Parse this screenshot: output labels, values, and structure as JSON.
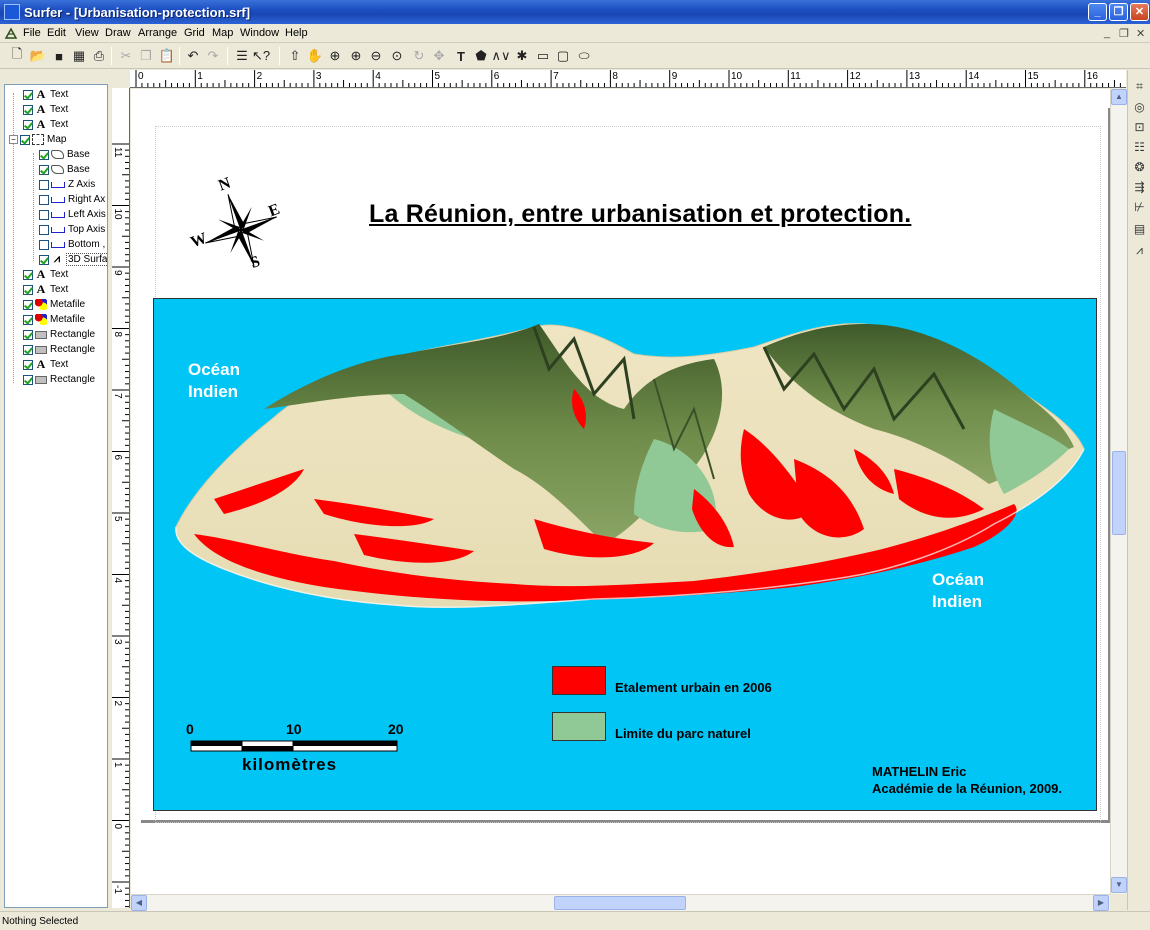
{
  "window": {
    "title": "Surfer - [Urbanisation-protection.srf]",
    "minimize_glyph": "_",
    "maximize_glyph": "❐",
    "close_glyph": "✕"
  },
  "menu": {
    "items": [
      "File",
      "Edit",
      "View",
      "Draw",
      "Arrange",
      "Grid",
      "Map",
      "Window",
      "Help"
    ],
    "mdi_minimize": "_",
    "mdi_restore": "❐",
    "mdi_close": "✕"
  },
  "toolbar": {
    "icons": [
      "new-icon",
      "open-icon",
      "save-icon",
      "grid-icon",
      "print-icon",
      "cut-icon",
      "copy-icon",
      "paste-icon",
      "undo-icon",
      "redo-icon",
      "object-manager-icon",
      "help-pointer-icon",
      "select-icon",
      "pan-icon",
      "zoom-in-icon",
      "zoom-realtime-icon",
      "zoom-out-icon",
      "zoom-selected-icon",
      "rotate-icon",
      "reshape-icon",
      "text-icon",
      "polygon-icon",
      "polyline-icon",
      "symbol-icon",
      "rectangle-icon",
      "rounded-rectangle-icon",
      "ellipse-icon"
    ]
  },
  "object_manager": {
    "items": [
      {
        "label": "Text",
        "type": "text",
        "checked": true,
        "level": 0
      },
      {
        "label": "Text",
        "type": "text",
        "checked": true,
        "level": 0
      },
      {
        "label": "Text",
        "type": "text",
        "checked": true,
        "level": 0
      },
      {
        "label": "Map",
        "type": "map",
        "checked": true,
        "level": 0,
        "expanded": true
      },
      {
        "label": "Base",
        "type": "base",
        "checked": true,
        "level": 1
      },
      {
        "label": "Base",
        "type": "base",
        "checked": true,
        "level": 1
      },
      {
        "label": "Z Axis",
        "type": "axis",
        "checked": false,
        "level": 1
      },
      {
        "label": "Right Ax",
        "type": "axis",
        "checked": false,
        "level": 1
      },
      {
        "label": "Left Axis",
        "type": "axis",
        "checked": false,
        "level": 1
      },
      {
        "label": "Top Axis",
        "type": "axis",
        "checked": false,
        "level": 1
      },
      {
        "label": "Bottom ,",
        "type": "axis",
        "checked": false,
        "level": 1
      },
      {
        "label": "3D Surfa",
        "type": "surface",
        "checked": true,
        "level": 1
      },
      {
        "label": "Text",
        "type": "text",
        "checked": true,
        "level": 0
      },
      {
        "label": "Text",
        "type": "text",
        "checked": true,
        "level": 0
      },
      {
        "label": "Metafile",
        "type": "metafile",
        "checked": true,
        "level": 0
      },
      {
        "label": "Metafile",
        "type": "metafile",
        "checked": true,
        "level": 0
      },
      {
        "label": "Rectangle",
        "type": "rect",
        "checked": true,
        "level": 0
      },
      {
        "label": "Rectangle",
        "type": "rect",
        "checked": true,
        "level": 0
      },
      {
        "label": "Text",
        "type": "text",
        "checked": true,
        "level": 0
      },
      {
        "label": "Rectangle",
        "type": "rect",
        "checked": true,
        "level": 0
      }
    ]
  },
  "rulers": {
    "horizontal_labels": [
      "0",
      "1",
      "2",
      "3",
      "4",
      "5",
      "6",
      "7",
      "8",
      "9",
      "10",
      "11",
      "12",
      "13",
      "14",
      "15",
      "16"
    ],
    "vertical_labels": [
      "11",
      "10",
      "9",
      "8",
      "7",
      "6",
      "5",
      "4",
      "3",
      "2",
      "1",
      "0",
      "-1"
    ]
  },
  "map": {
    "title": "La Réunion, entre urbanisation et protection.",
    "compass": {
      "n": "N",
      "e": "E",
      "s": "S",
      "w": "W"
    },
    "ocean_label_1": [
      "Océan",
      "Indien"
    ],
    "ocean_label_2": [
      "Océan",
      "Indien"
    ],
    "legend": [
      {
        "label": "Etalement urbain en 2006",
        "color": "#ff0000"
      },
      {
        "label": "Limite du parc naturel",
        "color": "#90c995"
      }
    ],
    "scale": {
      "ticks": [
        "0",
        "10",
        "20"
      ],
      "unit": "kilomètres"
    },
    "credit": [
      "MATHELIN Eric",
      "Académie de la Réunion, 2009."
    ],
    "colors": {
      "ocean": "#00c5f5",
      "urban": "#ff0000",
      "park": "#90c995",
      "terrain": "#efe6c2",
      "forest": "#55743a"
    }
  },
  "right_toolbar": {
    "icons": [
      "new-base-map-icon",
      "new-contour-map-icon",
      "new-post-map-icon",
      "new-image-map-icon",
      "new-shaded-relief-icon",
      "new-vector-map-icon",
      "new-wireframe-icon",
      "new-surface-icon",
      "new-3d-icon"
    ]
  },
  "status": {
    "text": "Nothing Selected"
  }
}
